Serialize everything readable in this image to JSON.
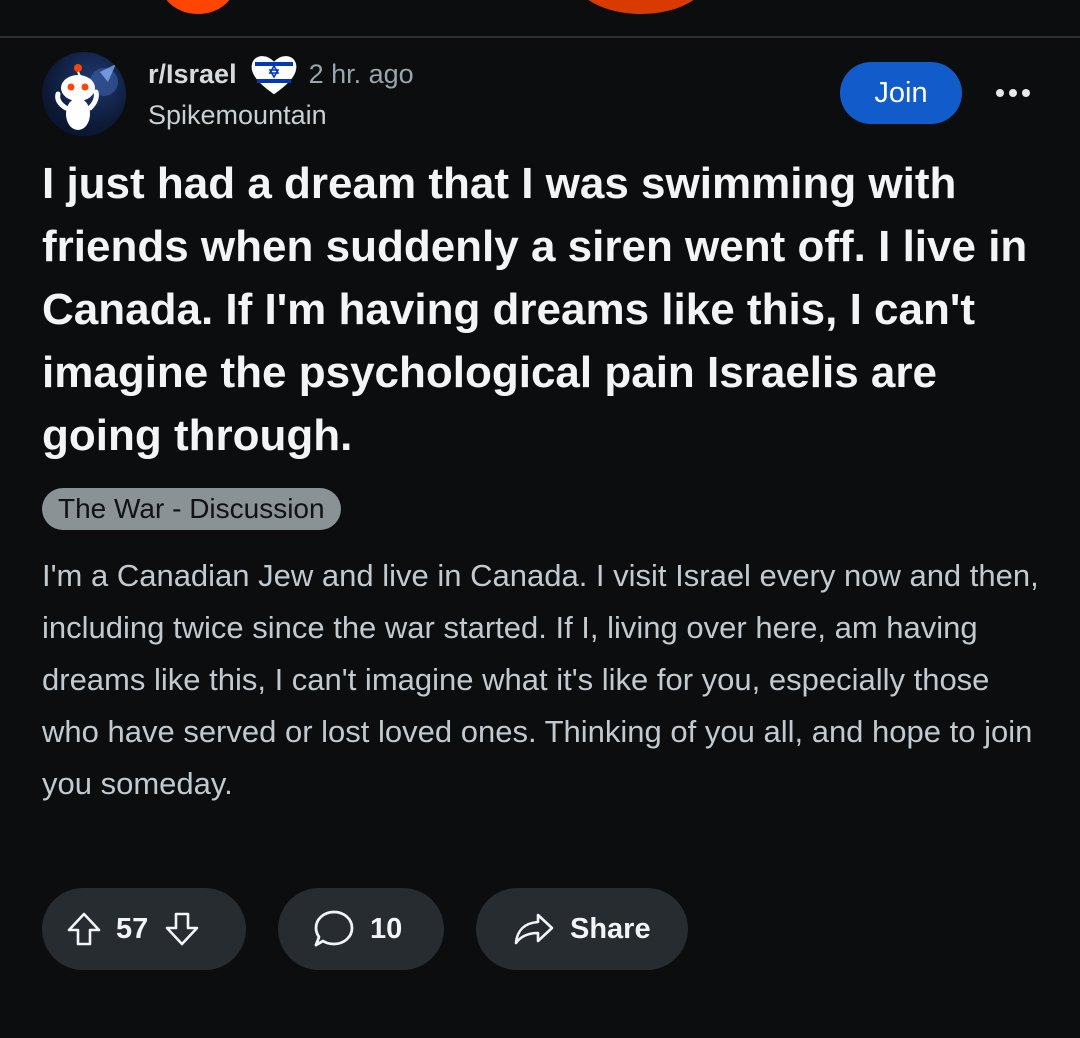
{
  "post": {
    "subreddit": "r/Israel",
    "flair_icon": "heart-israel-flag-icon",
    "time_ago": "2 hr. ago",
    "author": "Spikemountain",
    "join_label": "Join",
    "title": "I just had a dream that I was swimming with friends when suddenly a siren went off. I live in Canada. If I'm having dreams like this, I can't imagine the psychological pain Israelis are going through.",
    "flair": "The War - Discussion",
    "body": "I'm a Canadian Jew and live in Canada. I visit Israel every now and then, including twice since the war started. If I, living over here, am having dreams like this, I can't imagine what it's like for you, especially those who have served or lost loved ones. Thinking of you all, and hope to join you someday."
  },
  "actions": {
    "upvote_icon": "upvote-arrow-icon",
    "score": "57",
    "downvote_icon": "downvote-arrow-icon",
    "comment_icon": "comment-bubble-icon",
    "comments": "10",
    "share_icon": "share-arrow-icon",
    "share_label": "Share"
  },
  "colors": {
    "background": "#0b0d0f",
    "join_button": "#115bca",
    "pill_background": "#262c2f",
    "flair_background": "#8a9296",
    "reddit_orange": "#ff4500"
  }
}
